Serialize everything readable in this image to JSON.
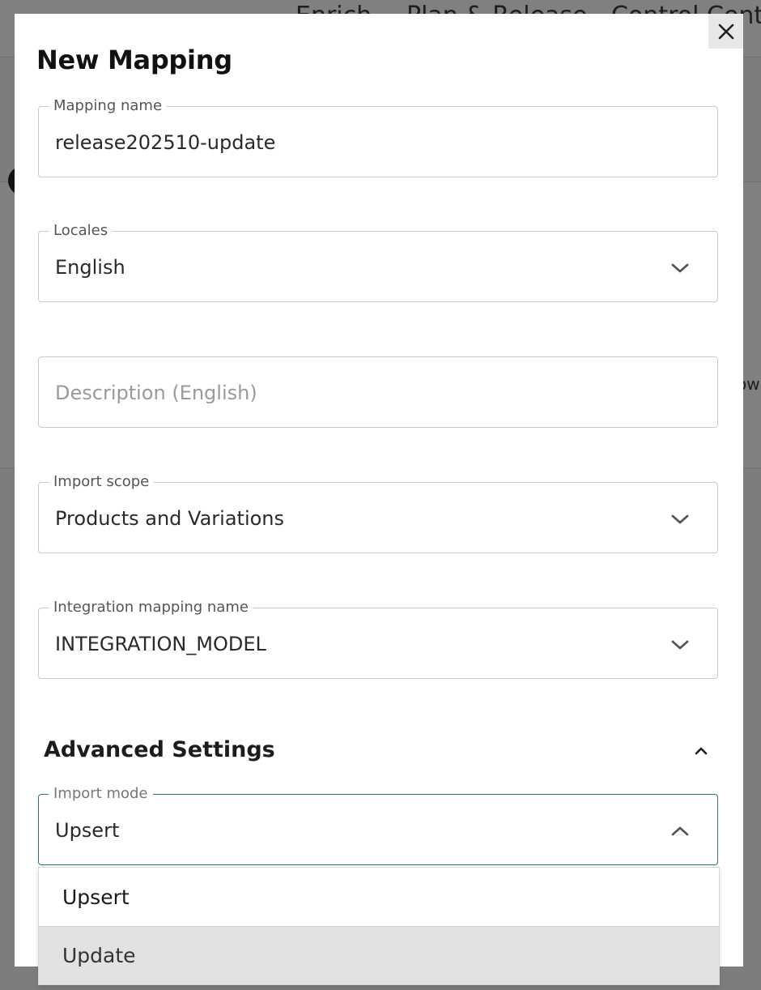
{
  "background": {
    "nav": [
      "Enrich",
      "Plan & Release",
      "Control Center"
    ],
    "side_text": "ow"
  },
  "modal": {
    "title": "New Mapping",
    "close_icon": "close-icon"
  },
  "form": {
    "mapping_name": {
      "label": "Mapping name",
      "value": "release202510-update"
    },
    "locales": {
      "label": "Locales",
      "value": "English",
      "icon": "chevron-down-icon"
    },
    "description": {
      "placeholder": "Description (English)"
    },
    "import_scope": {
      "label": "Import scope",
      "value": "Products and Variations",
      "icon": "chevron-down-icon"
    },
    "integration_mapping": {
      "label": "Integration mapping name",
      "value": "INTEGRATION_MODEL",
      "icon": "chevron-down-icon"
    }
  },
  "advanced": {
    "title": "Advanced Settings",
    "expanded": true,
    "toggle_icon": "chevron-up-icon",
    "import_mode": {
      "label": "Import mode",
      "value": "Upsert",
      "icon": "chevron-up-icon",
      "options": [
        "Upsert",
        "Update"
      ],
      "highlighted_index": 1
    }
  },
  "colors": {
    "focus_border": "#2e7d4f",
    "overlay": "#7f7f7f",
    "highlight": "#e2e2e2"
  }
}
